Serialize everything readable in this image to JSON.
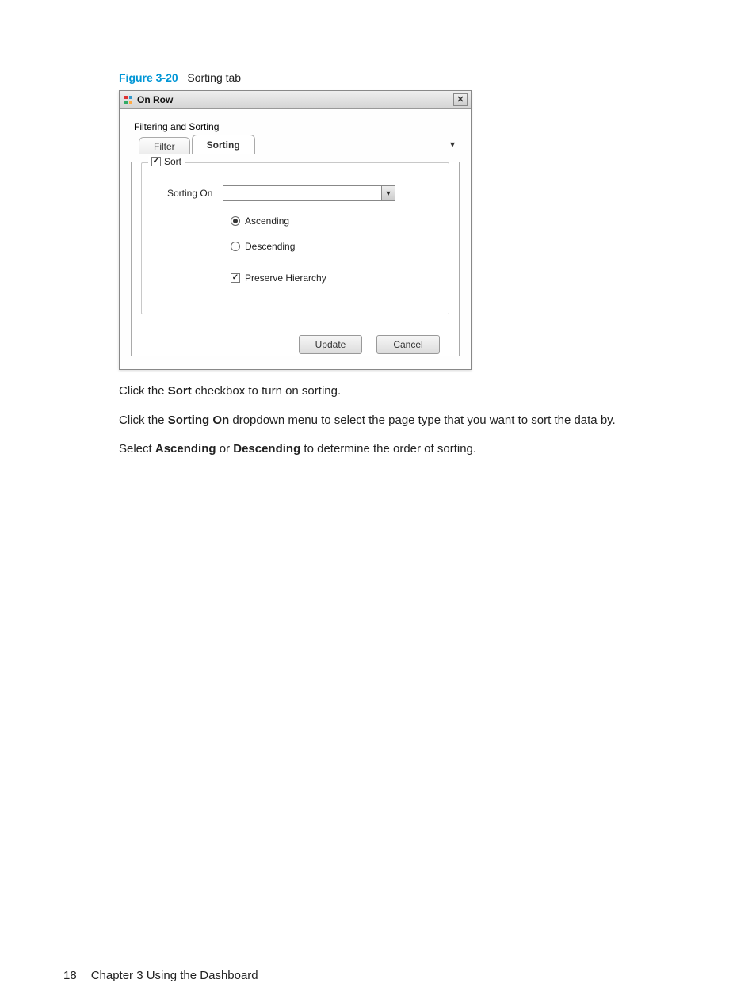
{
  "figure": {
    "number": "Figure 3-20",
    "title": "Sorting tab"
  },
  "dialog": {
    "title": "On Row",
    "close_tooltip": "Close",
    "group_label": "Filtering and Sorting",
    "tabs": {
      "filter": "Filter",
      "sorting": "Sorting"
    },
    "sort_checkbox_label": "Sort",
    "sorting_on_label": "Sorting On",
    "sorting_on_value": "",
    "order": {
      "ascending": "Ascending",
      "descending": "Descending"
    },
    "preserve_label": "Preserve Hierarchy",
    "buttons": {
      "update": "Update",
      "cancel": "Cancel"
    }
  },
  "instructions": {
    "line1_pre": "Click the ",
    "line1_bold": "Sort",
    "line1_post": " checkbox to turn on sorting.",
    "line2_pre": "Click the ",
    "line2_bold": "Sorting On",
    "line2_post": " dropdown menu to select the page type that you want to sort the data by.",
    "line3_pre": "Select ",
    "line3_bold1": "Ascending",
    "line3_mid": " or ",
    "line3_bold2": "Descending",
    "line3_post": " to determine the order of sorting."
  },
  "footer": {
    "page": "18",
    "chapter": "Chapter 3   Using the Dashboard"
  }
}
